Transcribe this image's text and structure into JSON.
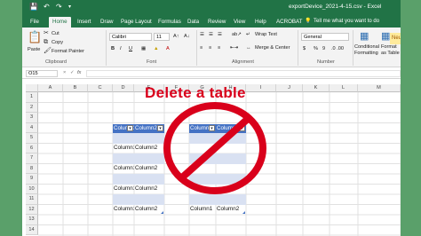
{
  "title_bar": {
    "file_title": "exportDevice_2021-4-15.csv  -  Excel",
    "save_icon": "save-icon",
    "undo_icon": "undo-icon",
    "redo_icon": "redo-icon"
  },
  "tabs": [
    "File",
    "Home",
    "Insert",
    "Draw",
    "Page Layout",
    "Formulas",
    "Data",
    "Review",
    "View",
    "Help",
    "ACROBAT"
  ],
  "tell_me": "Tell me what you want to do",
  "ribbon": {
    "paste": "Paste",
    "cut": "Cut",
    "copy": "Copy",
    "format_painter": "Format Painter",
    "clipboard": "Clipboard",
    "font_name": "Calibri",
    "font_size": "11",
    "bold": "B",
    "italic": "I",
    "underline": "U",
    "font": "Font",
    "wrap_text": "Wrap Text",
    "merge_center": "Merge & Center",
    "alignment": "Alignment",
    "number_format": "General",
    "currency": "$",
    "percent": "%",
    "comma": "9",
    "number": "Number",
    "conditional_formatting": "Conditional Formatting",
    "format_as_table": "Format as Table",
    "neutral": "Neutr"
  },
  "formula_bar": {
    "name_box": "O15",
    "fx": "fx",
    "cancel": "×",
    "enter": "✓"
  },
  "columns": [
    "A",
    "B",
    "C",
    "D",
    "E",
    "F",
    "G",
    "H",
    "I",
    "J",
    "K",
    "L",
    "M"
  ],
  "rows": [
    "1",
    "2",
    "3",
    "4",
    "5",
    "6",
    "7",
    "8",
    "9",
    "10",
    "11",
    "12",
    "13",
    "14"
  ],
  "table1": {
    "header": [
      "Column1",
      "Column2"
    ],
    "cells": [
      {
        "row": "6",
        "col": "D",
        "text": "Column1"
      },
      {
        "row": "6",
        "col": "E",
        "text": "Column2"
      },
      {
        "row": "8",
        "col": "D",
        "text": "Column1"
      },
      {
        "row": "8",
        "col": "E",
        "text": "Column2"
      },
      {
        "row": "10",
        "col": "D",
        "text": "Column1"
      },
      {
        "row": "10",
        "col": "E",
        "text": "Column2"
      },
      {
        "row": "12",
        "col": "D",
        "text": "Column1"
      },
      {
        "row": "12",
        "col": "E",
        "text": "Column2"
      }
    ]
  },
  "table2": {
    "header": [
      "Column1",
      "Column2"
    ],
    "cells": [
      {
        "row": "12",
        "col": "G",
        "text": "Column1"
      },
      {
        "row": "12",
        "col": "H",
        "text": "Column2"
      }
    ]
  },
  "overlay": {
    "headline": "Delete a table",
    "symbol": "prohibition-sign",
    "color": "#d9001b"
  },
  "colors": {
    "excel_green": "#217346",
    "table_header": "#4472c4",
    "table_band": "#d9e1f2",
    "frame_green": "#5aa06a"
  }
}
